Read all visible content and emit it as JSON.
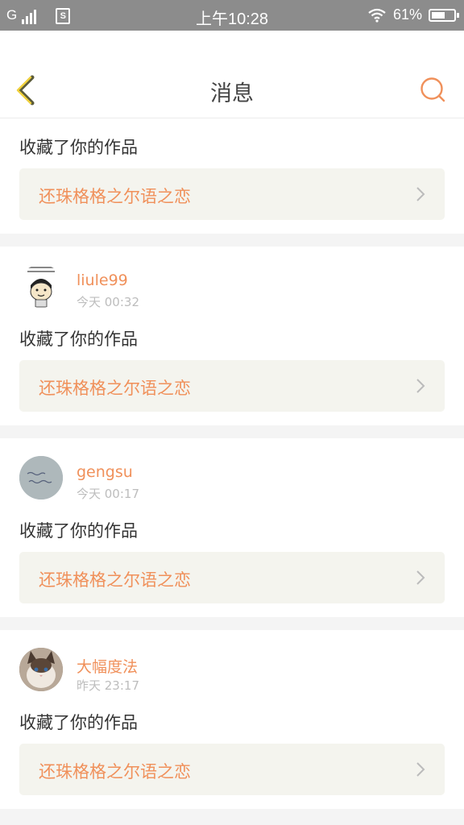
{
  "status_bar": {
    "carrier": "G",
    "time": "上午10:28",
    "battery": "61%",
    "battery_level": 0.61,
    "icons": [
      "signal-icon",
      "sim-icon",
      "wifi-icon",
      "battery-icon"
    ]
  },
  "header": {
    "title": "消息",
    "back_icon": "chevron-left-icon",
    "search_icon": "search-icon",
    "accent": "#f0905a"
  },
  "messages": [
    {
      "action": "收藏了你的作品",
      "work_title": "还珠格格之尔语之恋"
    },
    {
      "username": "liule99",
      "time": "今天 00:32",
      "action": "收藏了你的作品",
      "work_title": "还珠格格之尔语之恋"
    },
    {
      "username": "gengsu",
      "time": "今天 00:17",
      "action": "收藏了你的作品",
      "work_title": "还珠格格之尔语之恋"
    },
    {
      "username": "大幅度法",
      "time": "昨天 23:17",
      "action": "收藏了你的作品",
      "work_title": "还珠格格之尔语之恋"
    }
  ]
}
